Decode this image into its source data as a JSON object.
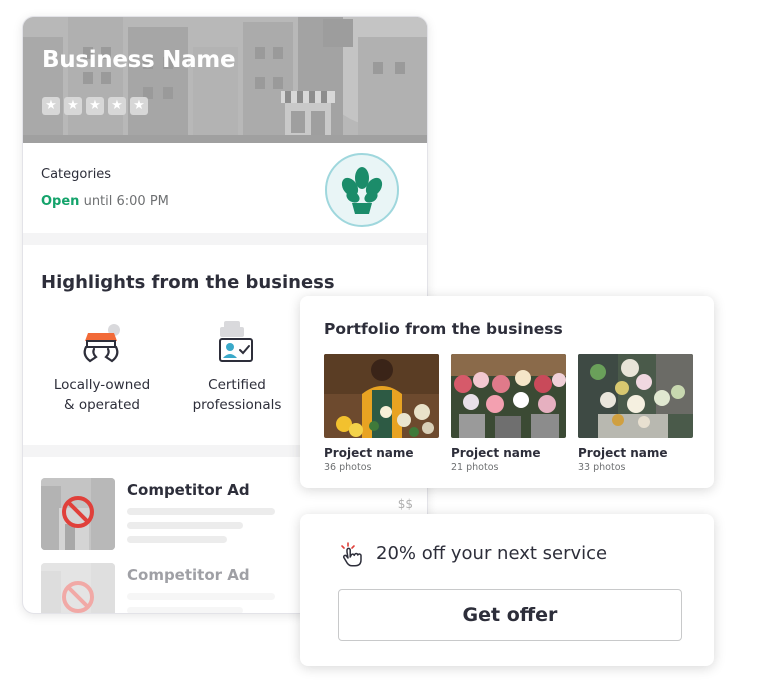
{
  "business": {
    "name": "Business Name",
    "rating_stars": 5,
    "categories_label": "Categories",
    "open_label": "Open",
    "hours_text": "until 6:00 PM",
    "logo_icon": "plant-logo-icon"
  },
  "highlights": {
    "title": "Highlights from the business",
    "items": [
      {
        "label_line1": "Locally-owned",
        "label_line2": "& operated",
        "icon": "local-shop-icon"
      },
      {
        "label_line1": "Certified",
        "label_line2": "professionals",
        "icon": "certified-badge-icon"
      }
    ]
  },
  "competitors": [
    {
      "title": "Competitor Ad",
      "price": "$$"
    },
    {
      "title": "Competitor Ad"
    }
  ],
  "portfolio": {
    "title": "Portfolio from the business",
    "projects": [
      {
        "name": "Project name",
        "count": "36 photos"
      },
      {
        "name": "Project name",
        "count": "21 photos"
      },
      {
        "name": "Project name",
        "count": "33 photos"
      }
    ]
  },
  "offer": {
    "text": "20% off your next service",
    "button_label": "Get offer",
    "icon": "tap-hand-icon"
  },
  "colors": {
    "open_green": "#14a36b",
    "logo_teal": "#1b8c6a",
    "text_dark": "#2d2e3a",
    "offer_red": "#e0403a"
  }
}
